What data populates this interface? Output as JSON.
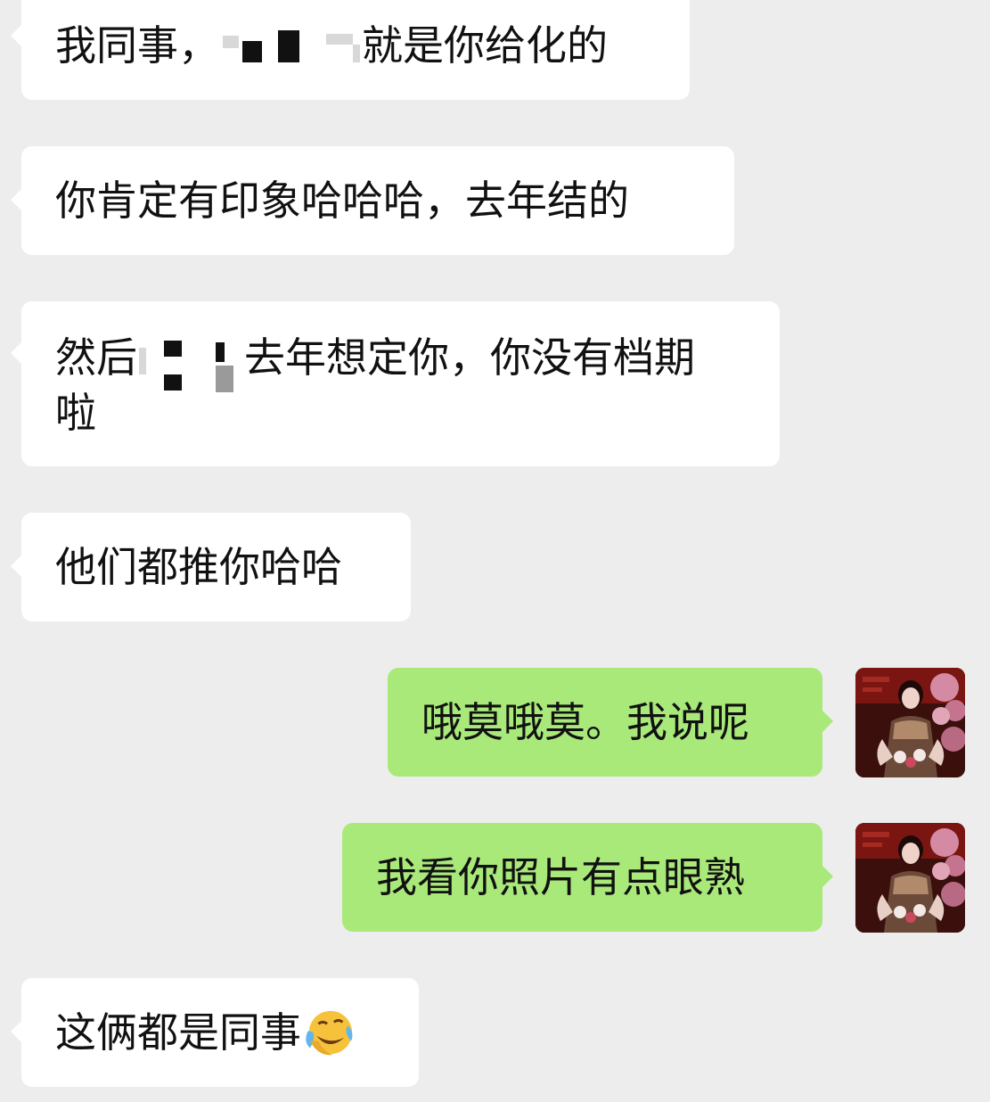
{
  "conversation": {
    "messages": [
      {
        "side": "left",
        "text_before": "我同事，",
        "redacted": true,
        "text_after": "就是你给化的"
      },
      {
        "side": "left",
        "text": "你肯定有印象哈哈哈，去年结的"
      },
      {
        "side": "left",
        "text_before": "然后",
        "redacted": true,
        "text_after": "去年想定你，你没有档期",
        "text_line2": "啦"
      },
      {
        "side": "left",
        "text": "他们都推你哈哈"
      },
      {
        "side": "right",
        "text": "哦莫哦莫。我说呢",
        "avatar": "user-avatar"
      },
      {
        "side": "right",
        "text": "我看你照片有点眼熟",
        "avatar": "user-avatar"
      },
      {
        "side": "left",
        "text": "这俩都是同事",
        "emoji": "face-with-tears-of-joy-rolling-icon"
      }
    ]
  },
  "colors": {
    "background": "#ededed",
    "received_bubble": "#ffffff",
    "sent_bubble": "#a9e97a",
    "text": "#111111"
  }
}
